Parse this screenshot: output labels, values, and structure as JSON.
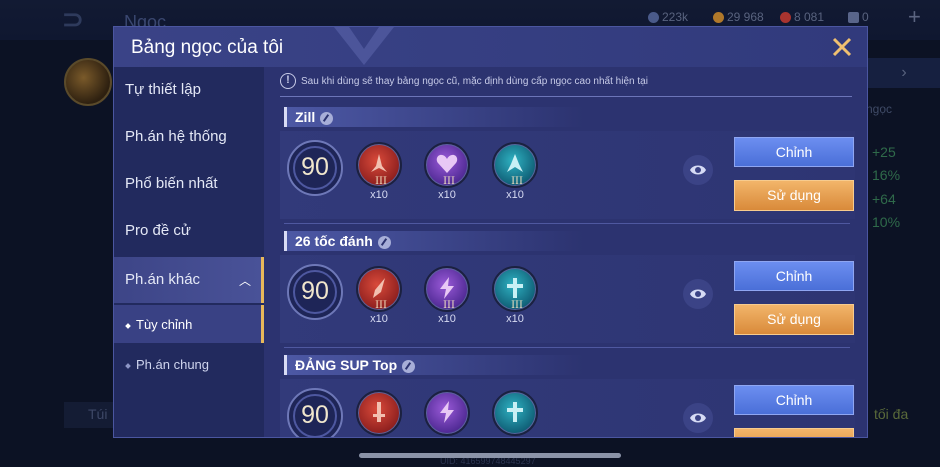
{
  "background": {
    "title": "Ngọc",
    "resources": [
      {
        "value": "223k",
        "color": "#5a6a9a"
      },
      {
        "value": "29 968",
        "color": "#d08a2a"
      },
      {
        "value": "8 081",
        "color": "#c03a3a"
      },
      {
        "value": "0",
        "color": "#6a7aa0"
      }
    ],
    "right_label": "ngọc",
    "stats": [
      "+25",
      "16%",
      "+64",
      "10%"
    ],
    "bag_label": "Túi",
    "max_label": "tối đa",
    "uid": "UID: 416599748445297"
  },
  "dialog": {
    "title": "Bảng ngọc của tôi",
    "notice": "Sau khi dùng sẽ thay bảng ngọc cũ, mặc định dùng cấp ngọc cao nhất hiện tại",
    "sidebar": {
      "items": [
        {
          "label": "Tự thiết lập"
        },
        {
          "label": "Ph.án hệ thống"
        },
        {
          "label": "Phổ biến nhất"
        },
        {
          "label": "Pro đề cử"
        },
        {
          "label": "Ph.án khác"
        }
      ],
      "sub_items": [
        {
          "label": "Tùy chỉnh"
        },
        {
          "label": "Ph.án chung"
        }
      ]
    },
    "sets": [
      {
        "name": "Zill",
        "level": "90",
        "gems": [
          {
            "tier": "III",
            "count": "x10",
            "color": "red"
          },
          {
            "tier": "III",
            "count": "x10",
            "color": "purple"
          },
          {
            "tier": "III",
            "count": "x10",
            "color": "teal"
          }
        ],
        "edit_label": "Chỉnh",
        "use_label": "Sử dụng"
      },
      {
        "name": "26 tốc đánh",
        "level": "90",
        "gems": [
          {
            "tier": "III",
            "count": "x10",
            "color": "red"
          },
          {
            "tier": "III",
            "count": "x10",
            "color": "purple"
          },
          {
            "tier": "III",
            "count": "x10",
            "color": "teal"
          }
        ],
        "edit_label": "Chỉnh",
        "use_label": "Sử dụng"
      },
      {
        "name": "ĐẢNG SUP Top",
        "level": "90",
        "gems": [
          {
            "tier": "",
            "count": "",
            "color": "red"
          },
          {
            "tier": "",
            "count": "",
            "color": "purple"
          },
          {
            "tier": "",
            "count": "",
            "color": "teal"
          }
        ],
        "edit_label": "Chỉnh",
        "use_label": ""
      }
    ]
  },
  "colors": {
    "dialog_bg": "#2c3370",
    "sidebar_bg": "#222a5e",
    "edit_button": "#5a7ee4",
    "use_button": "#e59d4f",
    "active_accent": "#e8b85a"
  }
}
